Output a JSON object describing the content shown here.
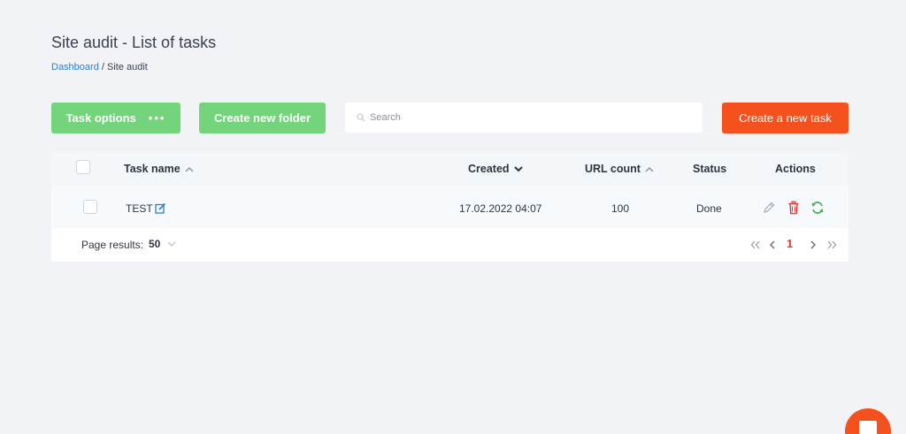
{
  "page": {
    "title": "Site audit - List of tasks",
    "breadcrumb": {
      "link": "Dashboard",
      "separator": " / ",
      "current": "Site audit"
    }
  },
  "toolbar": {
    "task_options_label": "Task options",
    "task_options_dots": "•••",
    "create_folder_label": "Create new folder",
    "search_placeholder": "Search",
    "create_task_label": "Create a new task"
  },
  "table": {
    "headers": {
      "task_name": "Task name",
      "created": "Created",
      "url_count": "URL count",
      "status": "Status",
      "actions": "Actions"
    },
    "rows": [
      {
        "name": "TEST",
        "created": "17.02.2022 04:07",
        "url_count": "100",
        "status": "Done"
      }
    ]
  },
  "pagination": {
    "page_results_label": "Page results:",
    "page_size": "50",
    "current_page": "1"
  },
  "colors": {
    "green_button": "#74d47b",
    "orange_button": "#f4511e",
    "link": "#2d7dd2",
    "delete_icon": "#e53935",
    "refresh_icon": "#4caf50"
  }
}
